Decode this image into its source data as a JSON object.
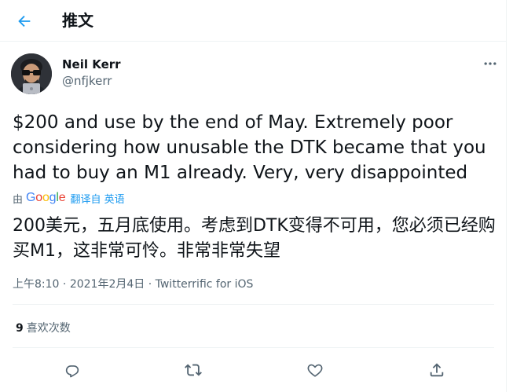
{
  "header": {
    "title": "推文"
  },
  "author": {
    "name": "Neil Kerr",
    "handle": "@nfjkerr"
  },
  "tweet": {
    "text": "$200 and use by the end of May. Extremely poor considering how unusable the DTK became that you had to buy an M1 already. Very, very disappointed",
    "translated_by": "由",
    "translation_service": "Google",
    "translate_link": "翻译自 英语",
    "translated_text": "200美元，五月底使用。考虑到DTK变得不可用，您必须已经购买M1，这非常可怜。非常非常失望"
  },
  "meta": {
    "time": "上午8:10",
    "separator": " · ",
    "date": "2021年2月4日",
    "source": "Twitterrific for iOS"
  },
  "stats": {
    "likes_count": "9",
    "likes_label": "喜欢次数"
  },
  "icons": {
    "back": "arrow-left-icon",
    "more": "more-horizontal-icon",
    "reply": "reply-icon",
    "retweet": "retweet-icon",
    "like": "heart-icon",
    "share": "share-icon"
  },
  "colors": {
    "accent": "#1d9bf0",
    "secondary_text": "#536471",
    "divider": "#eff3f4"
  }
}
